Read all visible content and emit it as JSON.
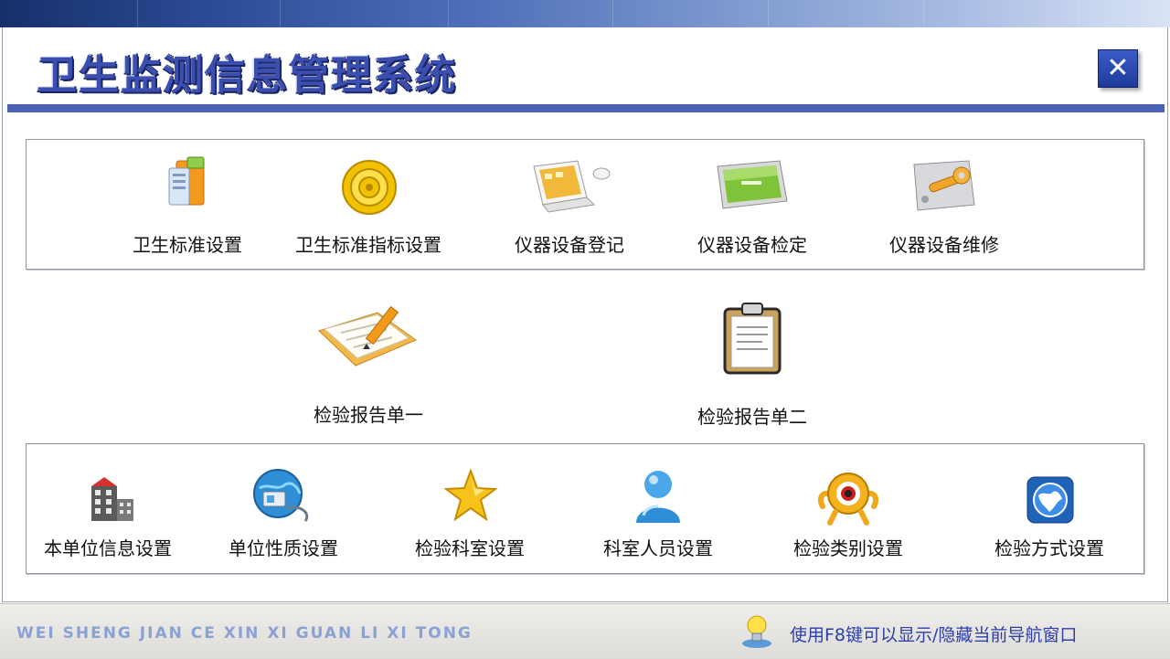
{
  "header": {
    "title": "卫生监测信息管理系统",
    "close_label": "✕"
  },
  "row1": [
    {
      "label": "卫生标准设置",
      "icon": "folder-document-icon"
    },
    {
      "label": "卫生标准指标设置",
      "icon": "target-icon"
    },
    {
      "label": "仪器设备登记",
      "icon": "laptop-mouse-icon"
    },
    {
      "label": "仪器设备检定",
      "icon": "monitor-icon"
    },
    {
      "label": "仪器设备维修",
      "icon": "wrench-icon"
    }
  ],
  "row2": [
    {
      "label": "检验报告单一",
      "icon": "notepad-pencil-icon"
    },
    {
      "label": "检验报告单二",
      "icon": "clipboard-icon"
    }
  ],
  "row3": [
    {
      "label": "本单位信息设置",
      "icon": "building-icon"
    },
    {
      "label": "单位性质设置",
      "icon": "globe-phone-icon"
    },
    {
      "label": "检验科室设置",
      "icon": "star-icon"
    },
    {
      "label": "科室人员设置",
      "icon": "user-icon"
    },
    {
      "label": "检验类别设置",
      "icon": "eye-figure-icon"
    },
    {
      "label": "检验方式设置",
      "icon": "world-icon"
    }
  ],
  "footer": {
    "left_text": "WEI SHENG JIAN CE XIN XI GUAN LI XI TONG",
    "right_text": "使用F8键可以显示/隐藏当前导航窗口",
    "hint_icon": "lightbulb-icon"
  },
  "colors": {
    "title": "#3a4fb0",
    "accent_rule": "#4b63b7",
    "footer_hint": "#2c3fa7",
    "footer_pinyin": "#8aa2d2"
  }
}
